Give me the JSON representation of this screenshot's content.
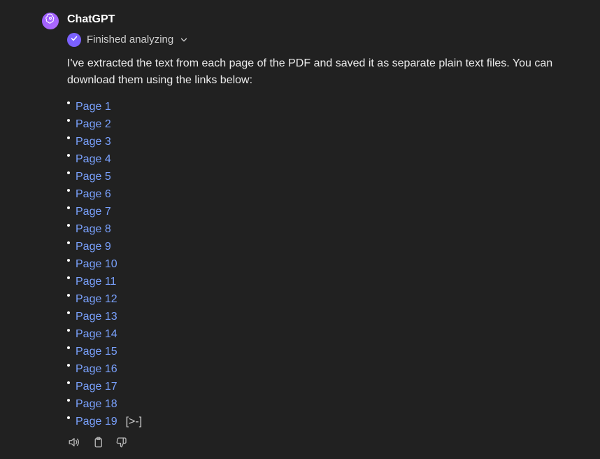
{
  "assistant": {
    "name": "ChatGPT",
    "status_label": "Finished analyzing",
    "brand_gradient_start": "#9a5cff",
    "brand_gradient_end": "#b06bff",
    "badge_color": "#7b61ff"
  },
  "message": {
    "text": "I've extracted the text from each page of the PDF and saved it as separate plain text files. You can download them using the links below:",
    "link_color": "#7aa2ff",
    "pages": [
      {
        "label": "Page 1"
      },
      {
        "label": "Page 2"
      },
      {
        "label": "Page 3"
      },
      {
        "label": "Page 4"
      },
      {
        "label": "Page 5"
      },
      {
        "label": "Page 6"
      },
      {
        "label": "Page 7"
      },
      {
        "label": "Page 8"
      },
      {
        "label": "Page 9"
      },
      {
        "label": "Page 10"
      },
      {
        "label": "Page 11"
      },
      {
        "label": "Page 12"
      },
      {
        "label": "Page 13"
      },
      {
        "label": "Page 14"
      },
      {
        "label": "Page 15"
      },
      {
        "label": "Page 16"
      },
      {
        "label": "Page 17"
      },
      {
        "label": "Page 18"
      },
      {
        "label": "Page 19",
        "note": "[>-]"
      }
    ]
  },
  "actions": {
    "read_aloud": "read-aloud",
    "copy": "copy",
    "dislike": "dislike"
  }
}
